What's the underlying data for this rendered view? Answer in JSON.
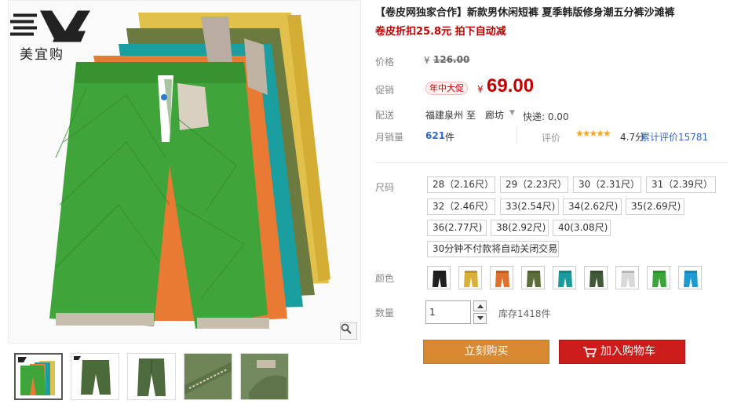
{
  "brand": {
    "name": "美宜购"
  },
  "product": {
    "title": "【卷皮网独家合作】新款男休闲短裤 夏季韩版修身潮五分裤沙滩裤",
    "subtitle": "卷皮折扣25.8元 拍下自动减"
  },
  "price": {
    "label": "价格",
    "currency": "¥",
    "original": "126.00",
    "promo_label": "促销",
    "promo_badge": "年中大促",
    "current": "69.00"
  },
  "shipping": {
    "label": "配送",
    "from": "福建泉州",
    "to_word": "至",
    "to_city": "廊坊",
    "fee": "快递: 0.00"
  },
  "sales": {
    "label": "月销量",
    "count": "621",
    "unit": "件",
    "review_label": "评价",
    "stars": "★★★★★",
    "score": "4.7分",
    "review_link": "累计评价15781"
  },
  "size": {
    "label": "尺码",
    "options": [
      "28（2.16尺）",
      "29（2.23尺）",
      "30（2.31尺）",
      "31（2.39尺）",
      "32（2.46尺）",
      "33(2.54尺)",
      "34(2.62尺)",
      "35(2.69尺)",
      "36(2.77尺)",
      "38(2.92尺)",
      "40(3.08尺)",
      "30分钟不付款将自动关闭交易"
    ]
  },
  "color": {
    "label": "颜色",
    "swatches": [
      "#1f1f1f",
      "#d9b13a",
      "#e0702e",
      "#5b6e3a",
      "#1a9a9c",
      "#3f5a36",
      "#d8d8d8",
      "#3aa63a",
      "#1d9bd0"
    ]
  },
  "quantity": {
    "label": "数量",
    "value": "1",
    "stock": "库存1418件"
  },
  "actions": {
    "buy_now": "立刻购买",
    "add_to_cart": "加入购物车"
  },
  "icons": {
    "zoom": "magnifier-icon",
    "cart": "cart-icon",
    "dropdown": "triangle-down-icon",
    "qty_up": "chevron-up-icon",
    "qty_down": "chevron-down-icon"
  }
}
